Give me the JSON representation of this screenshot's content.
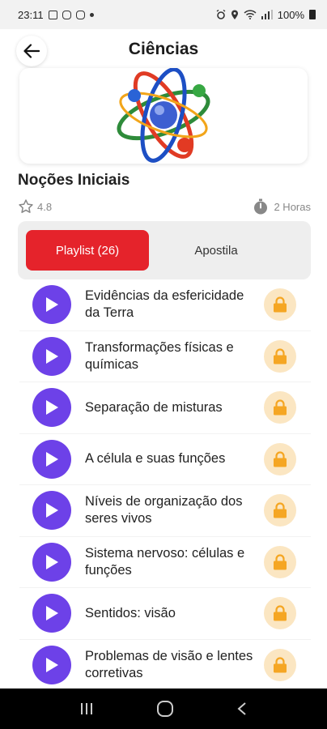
{
  "status_bar": {
    "time": "23:11",
    "battery": "100%"
  },
  "header": {
    "title": "Ciências"
  },
  "course": {
    "title": "Noções Iniciais",
    "rating": "4.8",
    "duration": "2 Horas"
  },
  "tabs": [
    {
      "label": "Playlist (26)",
      "active": true
    },
    {
      "label": "Apostila",
      "active": false
    }
  ],
  "lessons": [
    {
      "title": "Evidências da esfericidade da Terra",
      "locked": true
    },
    {
      "title": "Transformações físicas e químicas",
      "locked": true
    },
    {
      "title": "Separação de misturas",
      "locked": true
    },
    {
      "title": "A célula e suas funções",
      "locked": true
    },
    {
      "title": "Níveis de organização dos seres vivos",
      "locked": true
    },
    {
      "title": "Sistema nervoso: células e funções",
      "locked": true
    },
    {
      "title": "Sentidos: visão",
      "locked": true
    },
    {
      "title": "Problemas de visão e lentes corretivas",
      "locked": true
    }
  ],
  "colors": {
    "accent_red": "#e5232b",
    "play_purple": "#6d41e8",
    "lock_orange": "#f5a623",
    "lock_bg": "#fbe6c2"
  },
  "icons": {
    "back": "arrow-left-icon",
    "rating": "star-outline-icon",
    "duration": "stopwatch-icon",
    "play": "play-icon",
    "lock": "lock-icon"
  }
}
